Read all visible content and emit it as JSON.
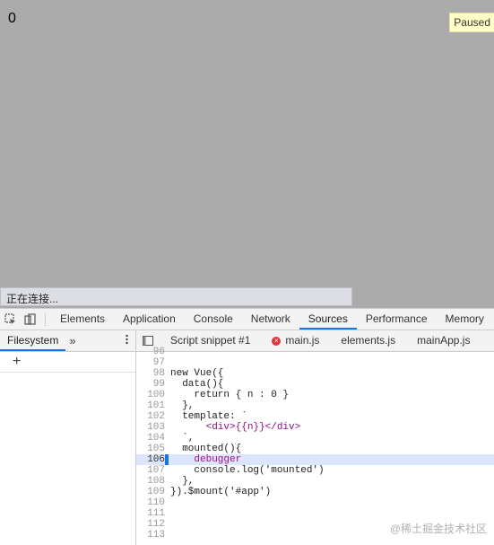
{
  "viewport": {
    "value": "0",
    "paused_label": "Paused",
    "status_text": "正在连接..."
  },
  "devtools": {
    "tabs": [
      {
        "label": "Elements"
      },
      {
        "label": "Application"
      },
      {
        "label": "Console"
      },
      {
        "label": "Network"
      },
      {
        "label": "Sources",
        "active": true
      },
      {
        "label": "Performance"
      },
      {
        "label": "Memory"
      }
    ],
    "left_pane": {
      "tab": "Filesystem",
      "more": "»",
      "add": "+"
    },
    "file_tabs": [
      {
        "label": "Script snippet #1"
      },
      {
        "label": "main.js",
        "error": true
      },
      {
        "label": "elements.js"
      },
      {
        "label": "mainApp.js"
      }
    ],
    "code_lines": [
      {
        "n": "96",
        "text": ""
      },
      {
        "n": "97",
        "text": ""
      },
      {
        "n": "98",
        "text": "new Vue({"
      },
      {
        "n": "99",
        "text": "  data(){"
      },
      {
        "n": "100",
        "text": "    return { n : 0 }"
      },
      {
        "n": "101",
        "text": "  },"
      },
      {
        "n": "102",
        "text": "  template: `"
      },
      {
        "n": "103",
        "text": "      <div>{{n}}</div>"
      },
      {
        "n": "104",
        "text": "  `,"
      },
      {
        "n": "105",
        "text": "  mounted(){"
      },
      {
        "n": "106",
        "text": "    debugger",
        "exec": true
      },
      {
        "n": "107",
        "text": "    console.log('mounted')"
      },
      {
        "n": "108",
        "text": "  },"
      },
      {
        "n": "109",
        "text": "}).$mount('#app')"
      },
      {
        "n": "110",
        "text": ""
      },
      {
        "n": "111",
        "text": ""
      },
      {
        "n": "112",
        "text": ""
      },
      {
        "n": "113",
        "text": ""
      }
    ]
  },
  "watermark": "@稀土掘金技术社区",
  "colors": {
    "accent": "#1a73e8",
    "viewport_bg": "#ababab",
    "exec_line": "#dbe5fb"
  }
}
